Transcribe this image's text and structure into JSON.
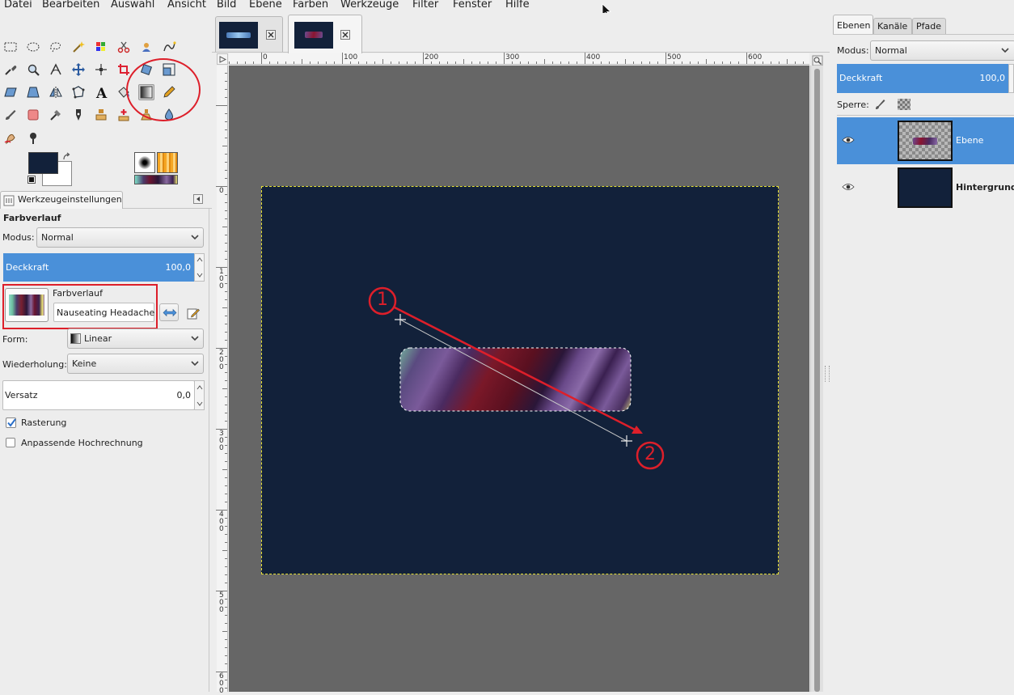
{
  "menu": [
    "Datei",
    "Bearbeiten",
    "Auswahl",
    "Ansicht",
    "Bild",
    "Ebene",
    "Farben",
    "Werkzeuge",
    "Filter",
    "Fenster",
    "Hilfe"
  ],
  "toolbox": {
    "tools": [
      "rect-select",
      "ellipse-select",
      "free-select",
      "fuzzy-select",
      "color-select",
      "scissors-select",
      "foreground-select",
      "paths",
      "color-picker",
      "zoom",
      "measure",
      "move",
      "align",
      "crop",
      "rotate",
      "scale",
      "shear",
      "perspective",
      "flip",
      "cage-transform",
      "text",
      "bucket-fill",
      "blend",
      "pencil",
      "paintbrush",
      "eraser",
      "airbrush",
      "ink",
      "clone",
      "heal",
      "perspective-clone",
      "blur",
      "smudge",
      "dodge-burn"
    ],
    "active_tool": "blend",
    "fg_color": "#12213a",
    "bg_color": "#ffffff"
  },
  "tool_options": {
    "tab_label": "Werkzeugeinstellungen",
    "title": "Farbverlauf",
    "mode_label": "Modus:",
    "mode_value": "Normal",
    "opacity_label": "Deckkraft",
    "opacity_value": "100,0",
    "gradient_label": "Farbverlauf",
    "gradient_name": "Nauseating Headache",
    "shape_label": "Form:",
    "shape_value": "Linear",
    "repeat_label": "Wiederholung:",
    "repeat_value": "Keine",
    "offset_label": "Versatz",
    "offset_value": "0,0",
    "dithering_label": "Rasterung",
    "dithering_checked": true,
    "adaptive_label": "Anpassende Hochrechnung",
    "adaptive_checked": false
  },
  "ruler": {
    "h_labels": [
      "0",
      "100",
      "200",
      "300",
      "400",
      "500",
      "600"
    ],
    "v_labels": [
      "0",
      "100",
      "200",
      "300",
      "400",
      "500",
      "600"
    ]
  },
  "annotations": {
    "start_number": "1",
    "end_number": "2",
    "accent": "#dd1f2a"
  },
  "layers_dock": {
    "tabs": [
      "Ebenen",
      "Kanäle",
      "Pfade"
    ],
    "mode_label": "Modus:",
    "mode_value": "Normal",
    "opacity_label": "Deckkraft",
    "opacity_value": "100,0",
    "lock_label": "Sperre:",
    "layers": [
      {
        "name": "Ebene",
        "selected": true
      },
      {
        "name": "Hintergrund",
        "selected": false
      }
    ]
  }
}
